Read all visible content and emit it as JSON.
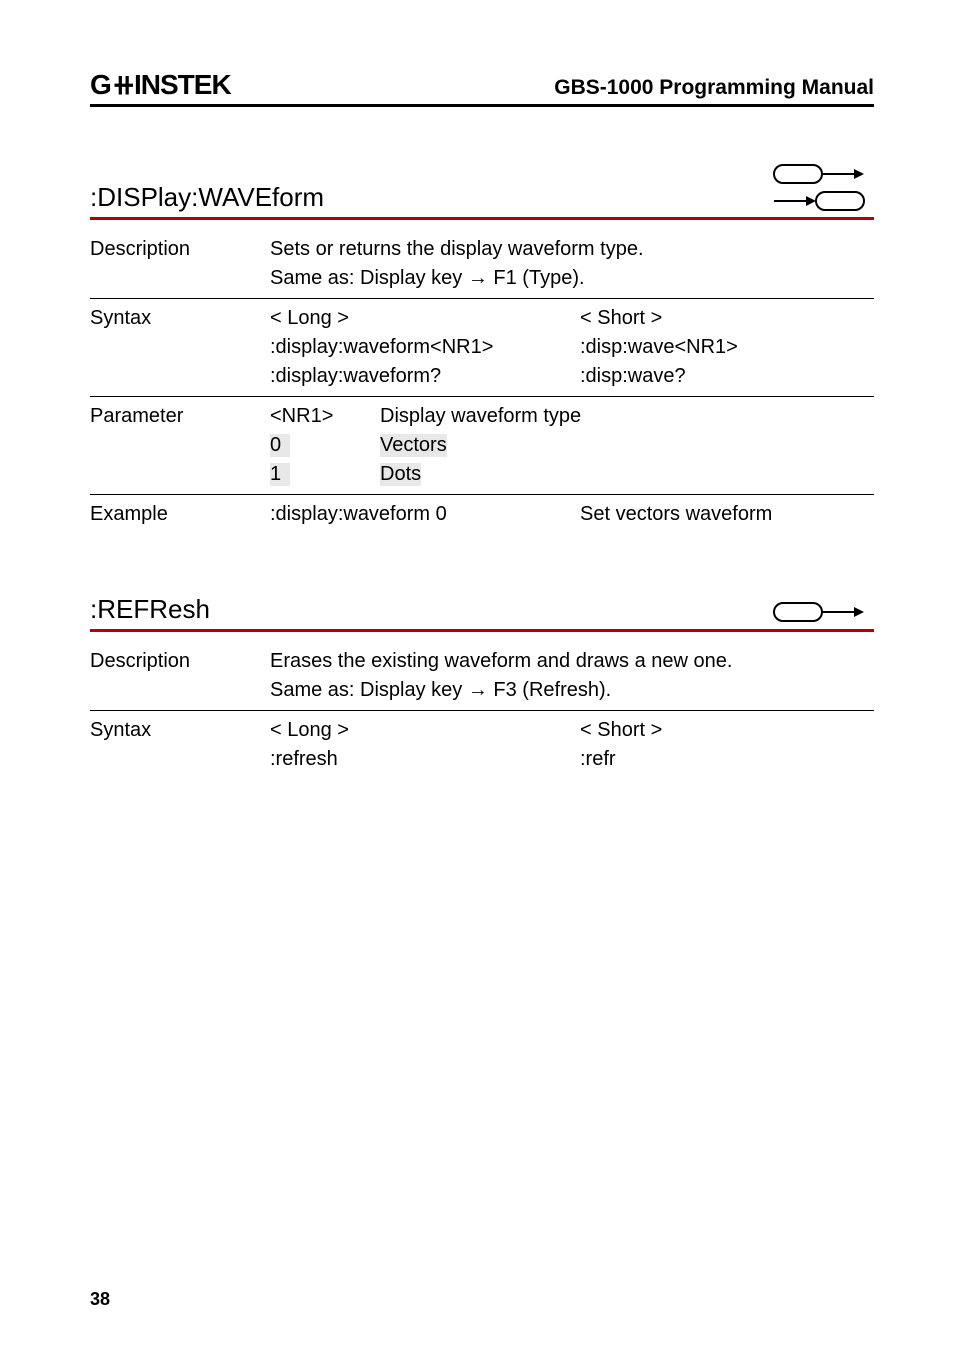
{
  "header": {
    "logo_html": "G<span style='font-size:22px;position:relative;top:-2px;'>⟂</span>INSTEK",
    "logo_text": "GWINSTEK",
    "manual_title": "GBS-1000 Programming Manual"
  },
  "section1": {
    "heading": ":DISPlay:WAVEform",
    "desc_label": "Description",
    "desc_line1": "Sets or returns the display waveform type.",
    "desc_line2": "Same as: Display key → F1 (Type).",
    "syntax_label": "Syntax",
    "long_label": "< Long >",
    "short_label": "< Short >",
    "long1": ":display:waveform<NR1>",
    "short1": ":disp:wave<NR1>",
    "long2": ":display:waveform?",
    "short2": ":disp:wave?",
    "param_label": "Parameter",
    "param_nr1": "<NR1>",
    "param_nr1_desc": "Display waveform type",
    "param_0": "0",
    "param_0_desc": "Vectors",
    "param_1": "1",
    "param_1_desc": "Dots",
    "example_label": "Example",
    "example_cmd": ":display:waveform 0",
    "example_desc": "Set vectors waveform"
  },
  "section2": {
    "heading": ":REFResh",
    "desc_label": "Description",
    "desc_line1": "Erases the existing waveform and draws a new one.",
    "desc_line2": "Same as: Display key → F3 (Refresh).",
    "syntax_label": "Syntax",
    "long_label": "< Long >",
    "short_label": "< Short >",
    "long1": ":refresh",
    "short1": ":refr"
  },
  "page_number": "38"
}
